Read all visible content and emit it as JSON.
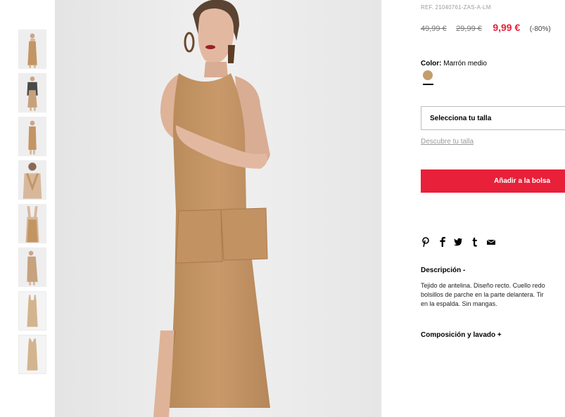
{
  "product": {
    "reference": "REF. 21040761-ZAS-A-LM",
    "prices": {
      "original": "49,99 €",
      "previous": "29,99 €",
      "current": "9,99 €",
      "discount": "(-80%)"
    },
    "price_color": "#e8203a",
    "color": {
      "label": "Color:",
      "value": "Marrón medio",
      "swatch_hex": "#c39e6c"
    },
    "size_select": {
      "placeholder": "Selecciona tu talla"
    },
    "size_guide_link": "Descubre tu talla",
    "add_to_bag": "Añadir a la bolsa",
    "share_icons": [
      "pinterest-icon",
      "facebook-icon",
      "twitter-icon",
      "tumblr-icon",
      "email-icon"
    ],
    "description": {
      "heading": "Descripción -",
      "lines": [
        "Tejido de antelina. Diseño recto. Cuello redo",
        "bolsillos de parche en la parte delantera. Tir",
        "en la espalda. Sin mangas."
      ]
    },
    "composition": {
      "heading": "Composición y lavado +"
    }
  },
  "gallery": {
    "thumbnail_count": 8,
    "main_image": "model-wearing-camel-suede-sleeveless-midi-dress"
  }
}
